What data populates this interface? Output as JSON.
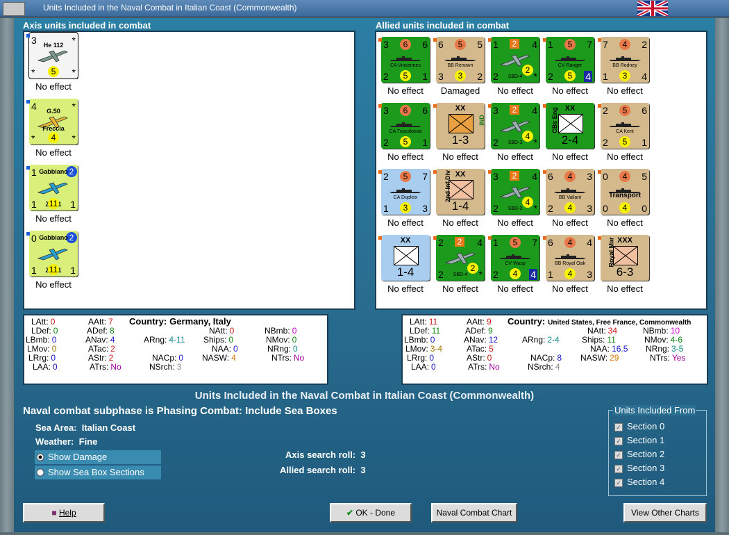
{
  "window": {
    "title": "Units Included in the Naval Combat in Italian Coast (Commonwealth)"
  },
  "axis_panel": {
    "title": "Axis units included in combat",
    "units": [
      {
        "name": "He 112",
        "tl": "3",
        "tr": "*",
        "bl": "*",
        "br": "*",
        "yellow": "5",
        "caption": "No effect"
      },
      {
        "name": "G.50",
        "sub": "Freccia",
        "tl": "4",
        "tr": "*",
        "bl": "*",
        "br": "*",
        "yellow": "4",
        "caption": "No effect"
      },
      {
        "name": "Gabbiano",
        "sub": "Z.501",
        "tl": "1",
        "blue": "2",
        "bl": "1",
        "br": "1",
        "yellow": "11",
        "caption": "No effect"
      },
      {
        "name": "Gabbiano",
        "sub": "Z.501",
        "tl": "0",
        "blue": "2",
        "bl": "1",
        "br": "1",
        "yellow": "11",
        "caption": "No effect"
      }
    ]
  },
  "allied_panel": {
    "title": "Allied units included in combat",
    "rows": [
      [
        {
          "name": "CA Vincennes",
          "tl": "3",
          "orange": "6",
          "tr": "6",
          "bl": "2",
          "yellow": "5",
          "br": "1",
          "caption": "No effect"
        },
        {
          "name": "BB Renown",
          "tl": "6",
          "orange": "5",
          "tr": "5",
          "bl": "3",
          "yellow": "3",
          "br": "2",
          "caption": "Damaged"
        },
        {
          "name": "SBD-4",
          "tl": "1",
          "orange_sq": "2",
          "tr": "4",
          "bl": "2",
          "yellow": "2",
          "br": "*",
          "caption": "No effect"
        },
        {
          "name": "CV Ranger",
          "tl": "1",
          "orange": "5",
          "tr": "7",
          "bl": "2",
          "yellow": "5",
          "br": "4",
          "caption": "No effect"
        },
        {
          "name": "BB Rodney",
          "tl": "7",
          "orange": "4",
          "tr": "2",
          "bl": "1",
          "yellow": "3",
          "br": "4",
          "caption": "No effect"
        }
      ],
      [
        {
          "name": "CA Tuscaloosa",
          "tl": "3",
          "orange": "6",
          "tr": "6",
          "bl": "2",
          "yellow": "5",
          "br": "1",
          "caption": "No effect"
        },
        {
          "name": "IND",
          "corps": "XX",
          "value": "1-3",
          "caption": "No effect"
        },
        {
          "name": "SBD-3",
          "tl": "3",
          "orange_sq": "2",
          "tr": "4",
          "bl": "2",
          "yellow": "4",
          "br": "*",
          "caption": "No effect"
        },
        {
          "name": "CBs Eng",
          "corps": "XX",
          "value": "2-4",
          "caption": "No effect"
        },
        {
          "name": "CA Kent",
          "tl": "2",
          "orange": "5",
          "tr": "6",
          "bl": "2",
          "yellow": "5",
          "br": "1",
          "caption": "No effect"
        }
      ],
      [
        {
          "name": "CA Dupleix",
          "tl": "2",
          "orange": "5",
          "tr": "7",
          "bl": "1",
          "yellow": "3",
          "br": "3",
          "caption": "No effect"
        },
        {
          "name": "2nd Inf Div",
          "corps": "XX",
          "value": "1-4",
          "caption": "No effect"
        },
        {
          "name": "SBD-3",
          "tl": "3",
          "orange_sq": "2",
          "tr": "4",
          "bl": "2",
          "yellow": "4",
          "br": "*",
          "caption": "No effect"
        },
        {
          "name": "BB Valiant",
          "tl": "6",
          "orange": "4",
          "tr": "3",
          "bl": "2",
          "yellow": "4",
          "br": "3",
          "caption": "No effect"
        },
        {
          "name": "Transport",
          "tl": "0",
          "orange": "4",
          "tr": "5",
          "bl": "0",
          "yellow": "4",
          "br": "0",
          "caption": "No effect"
        }
      ],
      [
        {
          "name": "",
          "corps": "XX",
          "value": "1-4",
          "caption": "No effect"
        },
        {
          "name": "SBD-4",
          "tl": "2",
          "orange_sq": "2",
          "tr": "4",
          "bl": "2",
          "yellow": "2",
          "br": "*",
          "caption": "No effect"
        },
        {
          "name": "CV Wasp",
          "tl": "1",
          "orange": "5",
          "tr": "7",
          "bl": "2",
          "yellow": "4",
          "br": "4",
          "caption": "No effect"
        },
        {
          "name": "BB Royal Oak",
          "tl": "6",
          "orange": "4",
          "tr": "4",
          "bl": "1",
          "yellow": "4",
          "br": "3",
          "caption": "No effect"
        },
        {
          "name": "Royal Mar",
          "corps": "XXX",
          "value": "6-3",
          "caption": "No effect"
        }
      ]
    ]
  },
  "axis_stats": {
    "country_label": "Country:",
    "country": "Germany, Italy",
    "LAtt": "0",
    "LDef": "0",
    "LBmb": "0",
    "LMov": "0",
    "LRrg": "0",
    "LAA": "0",
    "AAtt": "7",
    "ADef": "8",
    "ANav": "4",
    "ATac": "2",
    "AStr": "2",
    "ATrs": "No",
    "ARng": "4-11",
    "NACp": "0",
    "NSrch": "3",
    "NAtt": "0",
    "Ships": "0",
    "NAA": "0",
    "NASW": "4",
    "NBmb": "0",
    "NMov": "0",
    "NRng": "0",
    "NTrs": "No"
  },
  "allied_stats": {
    "country_label": "Country:",
    "country": "United States, Free France, Commonwealth",
    "LAtt": "11",
    "LDef": "11",
    "LBmb": "0",
    "LMov": "3-4",
    "LRrg": "0",
    "LAA": "0",
    "AAtt": "9",
    "ADef": "9",
    "ANav": "12",
    "ATac": "5",
    "AStr": "0",
    "ATrs": "No",
    "ARng": "2-4",
    "NACp": "8",
    "NSrch": "4",
    "NAtt": "34",
    "Ships": "11",
    "NAA": "16.5",
    "NASW": "29",
    "NBmb": "10",
    "NMov": "4-6",
    "NRng": "3-5",
    "NTrs": "Yes"
  },
  "stat_labels": {
    "LAtt": "LAtt:",
    "LDef": "LDef:",
    "LBmb": "LBmb:",
    "LMov": "LMov:",
    "LRrg": "LRrg:",
    "LAA": "LAA:",
    "AAtt": "AAtt:",
    "ADef": "ADef:",
    "ANav": "ANav:",
    "ATac": "ATac:",
    "AStr": "AStr:",
    "ATrs": "ATrs:",
    "ARng": "ARng:",
    "NACp": "NACp:",
    "NSrch": "NSrch:",
    "NAtt": "NAtt:",
    "Ships": "Ships:",
    "NAA": "NAA:",
    "NASW": "NASW:",
    "NBmb": "NBmb:",
    "NMov": "NMov:",
    "NRng": "NRng:",
    "NTrs": "NTrs:"
  },
  "main": {
    "heading": "Units Included in the Naval Combat in Italian Coast (Commonwealth)",
    "subphase": "Naval combat subphase is Phasing Combat: Include Sea Boxes",
    "sea_area_label": "Sea Area:",
    "sea_area": "Italian Coast",
    "weather_label": "Weather:",
    "weather": "Fine",
    "show_damage": "Show Damage",
    "show_sections": "Show Sea Box Sections",
    "axis_roll_label": "Axis search roll:",
    "axis_roll": "3",
    "allied_roll_label": "Allied search roll:",
    "allied_roll": "3"
  },
  "sections": {
    "title": "Units Included From",
    "items": [
      "Section 0",
      "Section 1",
      "Section 2",
      "Section 3",
      "Section 4"
    ]
  },
  "buttons": {
    "help": "Help",
    "ok": "OK - Done",
    "naval_chart": "Naval Combat Chart",
    "other_charts": "View Other Charts"
  },
  "colors": {
    "axis_val": "#d01818",
    "green_val": "#108810",
    "blue_val": "#1818d0"
  }
}
